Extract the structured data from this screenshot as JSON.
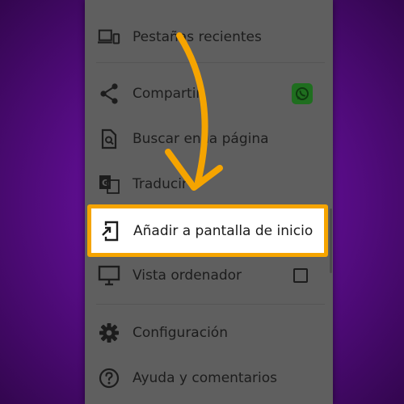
{
  "menu": {
    "items": [
      {
        "label": "Pestañas recientes",
        "icon": "devices-icon"
      },
      {
        "label": "Compartir",
        "icon": "share-icon"
      },
      {
        "label": "Buscar en la página",
        "icon": "find-in-page-icon"
      },
      {
        "label": "Traducir",
        "icon": "translate-icon"
      },
      {
        "label": "Añadir a pantalla de inicio",
        "icon": "add-to-home-screen-icon"
      },
      {
        "label": "Vista ordenador",
        "icon": "desktop-icon"
      },
      {
        "label": "Configuración",
        "icon": "gear-icon"
      },
      {
        "label": "Ayuda y comentarios",
        "icon": "help-icon"
      }
    ],
    "desktop_view_checked": false,
    "share_app": "whatsapp-icon"
  },
  "colors": {
    "background": "#5a0d8a",
    "menu": "#5f5f5f",
    "highlight": "#f5a400",
    "arrow": "#f5a400",
    "whatsapp": "#1f6e1f"
  }
}
